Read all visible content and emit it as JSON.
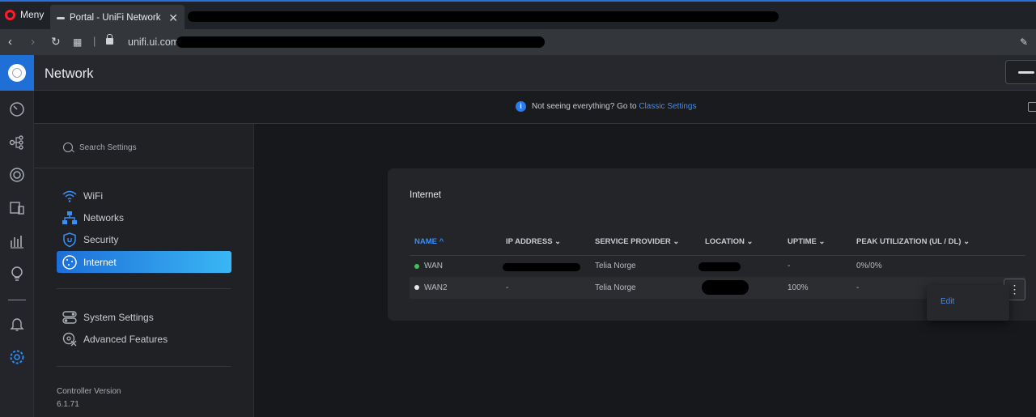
{
  "browser": {
    "menu_label": "Meny",
    "tab_title": "Portal - UniFi Network",
    "tab_close": "✕",
    "url": "unifi.ui.com/"
  },
  "header": {
    "title": "Network"
  },
  "notice": {
    "icon": "i",
    "text": "Not seeing everything? Go to ",
    "link": "Classic Settings"
  },
  "sidebar": {
    "search_placeholder": "Search Settings",
    "items": [
      {
        "label": "WiFi"
      },
      {
        "label": "Networks"
      },
      {
        "label": "Security"
      },
      {
        "label": "Internet"
      },
      {
        "label": "System Settings"
      },
      {
        "label": "Advanced Features"
      }
    ],
    "controller_label": "Controller Version",
    "controller_version": "6.1.71"
  },
  "internet": {
    "title": "Internet",
    "columns": [
      {
        "label": "NAME ^"
      },
      {
        "label": "IP ADDRESS ⌄"
      },
      {
        "label": "SERVICE PROVIDER ⌄"
      },
      {
        "label": "LOCATION ⌄"
      },
      {
        "label": "UPTIME ⌄"
      },
      {
        "label": "PEAK UTILIZATION (UL / DL) ⌄"
      }
    ],
    "rows": [
      {
        "name": "WAN",
        "status_color": "#3fc25a",
        "ip": "",
        "provider": "Telia Norge",
        "location": "",
        "uptime": "-",
        "peak": "0%/0%"
      },
      {
        "name": "WAN2",
        "status_color": "#e8e8e8",
        "ip": "-",
        "provider": "Telia Norge",
        "location": "",
        "uptime": "100%",
        "peak": "-"
      }
    ],
    "menu_icon": "⋮",
    "menu_items": [
      {
        "label": "Edit"
      }
    ]
  },
  "colors": {
    "accent": "#1f6fd6",
    "link": "#3b8ef5"
  }
}
